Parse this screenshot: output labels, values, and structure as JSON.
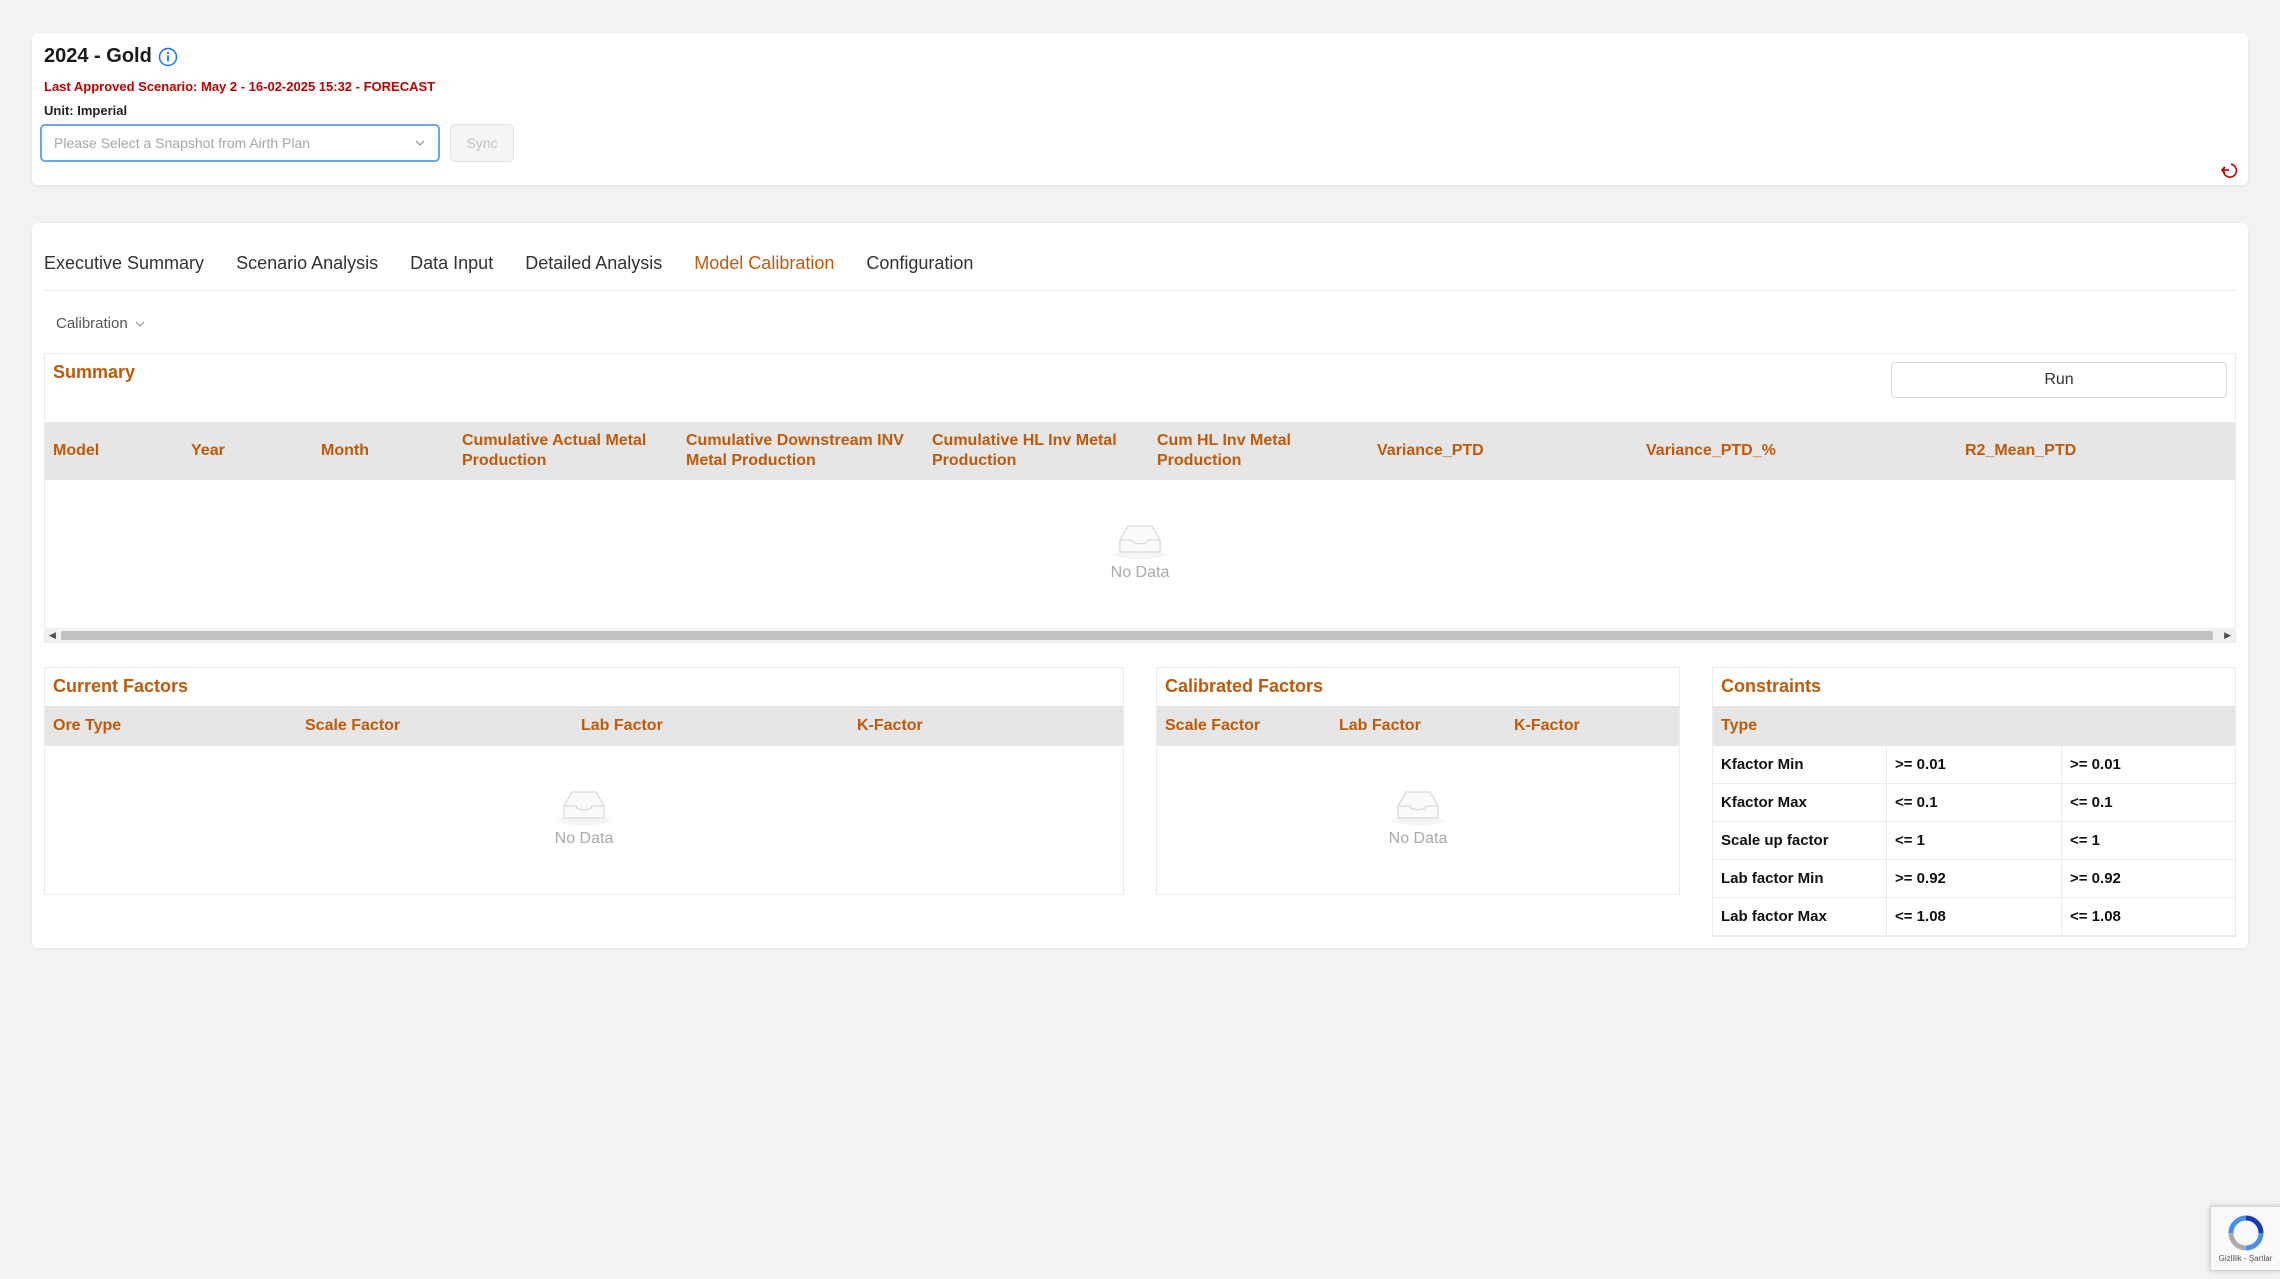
{
  "header": {
    "title": "2024 - Gold",
    "scenario": "Last Approved Scenario: May 2 - 16-02-2025 15:32 - FORECAST",
    "unit_label": "Unit:",
    "unit_value": "Imperial",
    "snapshot_placeholder": "Please Select a Snapshot from Airth Plan",
    "sync_label": "Sync"
  },
  "tabs": [
    {
      "label": "Executive Summary"
    },
    {
      "label": "Scenario Analysis"
    },
    {
      "label": "Data Input"
    },
    {
      "label": "Detailed Analysis"
    },
    {
      "label": "Model Calibration",
      "active": true
    },
    {
      "label": "Configuration"
    }
  ],
  "calibration_dropdown": "Calibration",
  "summary": {
    "title": "Summary",
    "run_label": "Run",
    "columns": [
      "Model",
      "Year",
      "Month",
      "Cumulative Actual Metal Production",
      "Cumulative Downstream INV Metal Production",
      "Cumulative HL Inv Metal Production",
      "Cum HL Inv Metal Production",
      "Variance_PTD",
      "Variance_PTD_%",
      "R2_Mean_PTD"
    ],
    "empty_text": "No Data"
  },
  "current_factors": {
    "title": "Current Factors",
    "columns": [
      "Ore Type",
      "Scale Factor",
      "Lab Factor",
      "K-Factor"
    ],
    "empty_text": "No Data"
  },
  "calibrated_factors": {
    "title": "Calibrated Factors",
    "columns": [
      "Scale Factor",
      "Lab Factor",
      "K-Factor"
    ],
    "empty_text": "No Data"
  },
  "constraints": {
    "title": "Constraints",
    "header": "Type",
    "rows": [
      [
        "Kfactor Min",
        ">= 0.01",
        ">= 0.01"
      ],
      [
        "Kfactor Max",
        "<= 0.1",
        "<= 0.1"
      ],
      [
        "Scale up factor",
        "<= 1",
        "<= 1"
      ],
      [
        "Lab factor Min",
        ">= 0.92",
        ">= 0.92"
      ],
      [
        "Lab factor Max",
        "<= 1.08",
        "<= 1.08"
      ]
    ]
  },
  "recaptcha_text": "Gizlilik - Şartlar",
  "colors": {
    "accent": "#c05a0a",
    "scenario_red": "#c00000",
    "select_border": "#6ca7e4",
    "info_blue": "#1677ff"
  }
}
